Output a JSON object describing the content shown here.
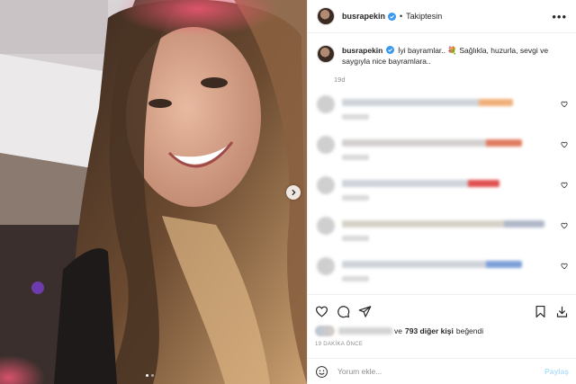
{
  "post": {
    "username": "busrapekin",
    "follow_status": "Takiptesin",
    "separator": "•",
    "more_label": "•••",
    "caption_text": "İyi bayramlar.. 💐 Sağlıkla, huzurla, sevgi ve saygıyla nice bayramlara..",
    "caption_age": "19d",
    "likes_text": "ve",
    "likes_count": "793 diğer kişi",
    "likes_suffix": "beğendi",
    "timestamp": "19 DAKİKA ÖNCE",
    "comment_placeholder": "Yorum ekle...",
    "post_label": "Paylaş"
  },
  "comments": [
    {
      "line_color": "#cfd3da",
      "line_width": 190,
      "accent": "#f0b07a"
    },
    {
      "line_color": "#d3cfcf",
      "line_width": 200,
      "accent": "#e07a5f"
    },
    {
      "line_color": "#cfd3da",
      "line_width": 175,
      "accent": "#e05050"
    },
    {
      "line_color": "#d6d2c8",
      "line_width": 225,
      "accent": "#b0b8c8"
    },
    {
      "line_color": "#cfd3da",
      "line_width": 200,
      "accent": "#7da0d8"
    }
  ],
  "icons": {
    "verified": "verified-badge-icon",
    "more": "more-options-icon",
    "heart": "heart-icon",
    "comment": "comment-icon",
    "share": "share-icon",
    "save": "bookmark-icon",
    "download": "download-icon",
    "emoji": "emoji-icon",
    "next": "chevron-right-icon"
  },
  "colors": {
    "verified_blue": "#3897f0",
    "muted_text": "#8e8e8e",
    "post_button": "#b2dffc"
  }
}
